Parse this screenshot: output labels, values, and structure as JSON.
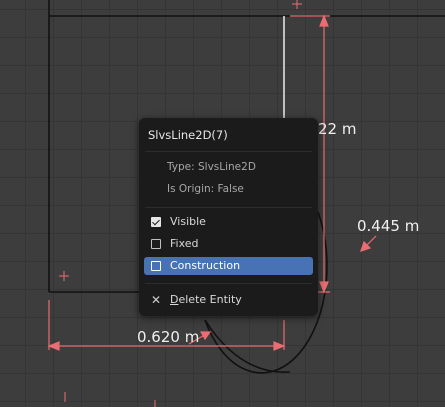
{
  "viewport": {
    "dimensions": [
      {
        "id": "dim-vertical",
        "text": "22 m"
      },
      {
        "id": "dim-radius",
        "text": "0.445 m"
      },
      {
        "id": "dim-horizontal",
        "text": "0.620 m"
      }
    ]
  },
  "context_menu": {
    "title": "SlvsLine2D(7)",
    "info": {
      "type": "Type: SlvsLine2D",
      "origin": "Is Origin: False"
    },
    "items": [
      {
        "label": "Visible",
        "checked": true,
        "active": false
      },
      {
        "label": "Fixed",
        "checked": false,
        "active": false
      },
      {
        "label": "Construction",
        "checked": false,
        "active": true
      }
    ],
    "delete_label": "Delete Entity",
    "delete_underline": "D",
    "delete_rest": "elete Entity"
  },
  "colors": {
    "background": "#3d3d3d",
    "grid": "#353535",
    "dimension": "#e96d72",
    "entity": "#111111",
    "selected_line": "#d0d0d0",
    "menu_bg": "#1b1b1b",
    "active_item": "#4772b3"
  }
}
